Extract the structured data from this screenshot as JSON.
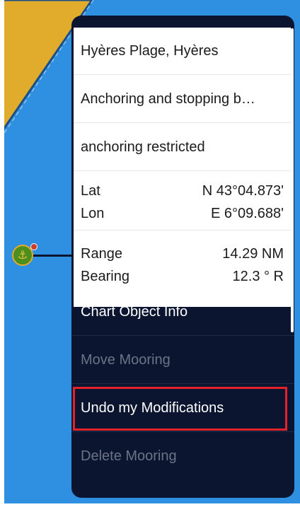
{
  "popup": {
    "place": "Hyères Plage, Hyères",
    "object_name": "Anchoring and stopping b…",
    "restriction": "anchoring restricted",
    "position": {
      "lat_label": "Lat",
      "lat_value": "N 43°04.873'",
      "lon_label": "Lon",
      "lon_value": "E 6°09.688'"
    },
    "navigation": {
      "range_label": "Range",
      "range_value": "14.29 NM",
      "bearing_label": "Bearing",
      "bearing_value": "12.3 ° R"
    }
  },
  "menu": {
    "items": [
      {
        "label": "Chart Object Info",
        "enabled": true
      },
      {
        "label": "Move Mooring",
        "enabled": false
      },
      {
        "label": "Undo my Modifications",
        "enabled": true,
        "highlighted": true
      },
      {
        "label": "Delete Mooring",
        "enabled": false
      }
    ]
  },
  "map": {
    "marker_icon": "anchor-icon",
    "colors": {
      "water": "#2f8fe0",
      "land": "#e1ab2b",
      "popup_bg": "#0b1530",
      "highlight": "#e3222a",
      "marker": "#4c8f1e"
    }
  }
}
